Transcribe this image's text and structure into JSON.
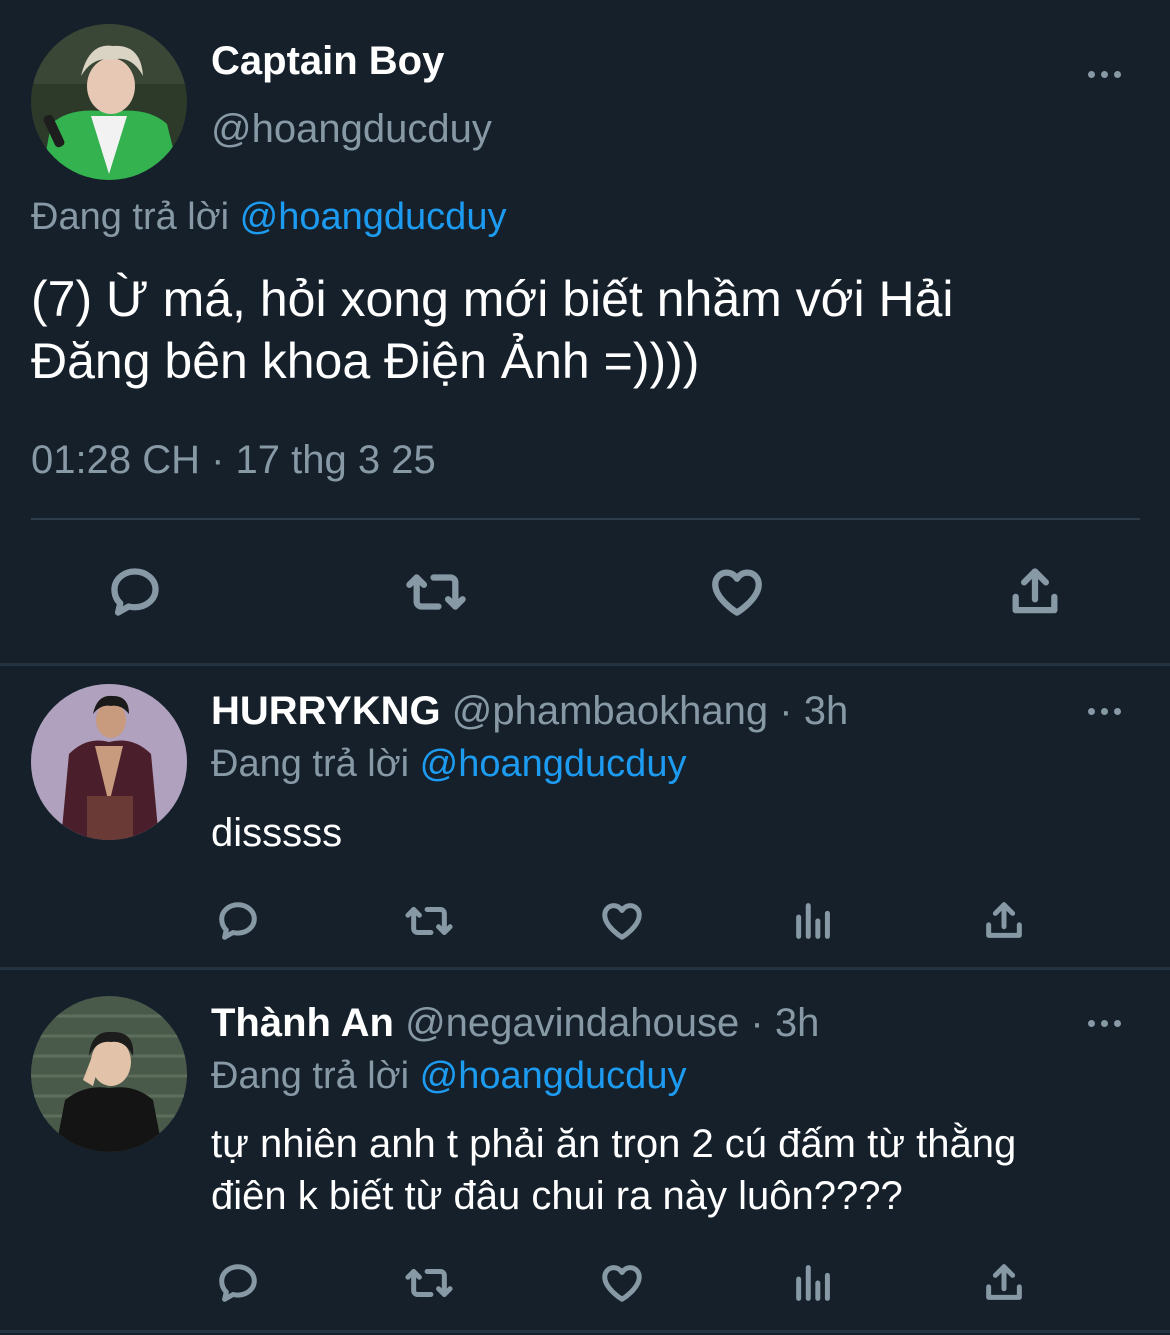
{
  "main_tweet": {
    "display_name": "Captain Boy",
    "handle": "@hoangducduy",
    "replying_label": "Đang trả lời",
    "replying_to": "@hoangducduy",
    "text_line1": "(7) Ừ má, hỏi xong mới biết nhầm với Hải",
    "text_line2": "Đăng bên khoa Điện Ảnh =))))",
    "timestamp": "01:28 CH · 17 thg 3 25",
    "avatar_colors": {
      "bg": "#2d3a2a",
      "jacket": "#33b24f",
      "hair": "#d9d4c4",
      "face": "#e6c8b4"
    }
  },
  "replies": [
    {
      "display_name": "HURRYKNG",
      "handle": "@phambaokhang",
      "time": "· 3h",
      "replying_label": "Đang trả lời",
      "replying_to": "@hoangducduy",
      "text_line1": "disssss",
      "text_line2": "",
      "avatar_colors": {
        "bg": "#b8a9c4",
        "jacket": "#4a1e2a",
        "hair": "#1a1a1a",
        "face": "#c89a7e"
      }
    },
    {
      "display_name": "Thành An",
      "handle": "@negavindahouse",
      "time": "· 3h",
      "replying_label": "Đang trả lời",
      "replying_to": "@hoangducduy",
      "text_line1": "tự nhiên anh t phải ăn trọn 2 cú đấm từ thằng",
      "text_line2": "điên k biết từ đâu chui ra này luôn????",
      "avatar_colors": {
        "bg": "#4a5a4a",
        "jacket": "#141414",
        "hair": "#1c1c1c",
        "face": "#e2c2a8"
      }
    }
  ],
  "icons": {
    "reply": "reply-icon",
    "retweet": "retweet-icon",
    "like": "heart-icon",
    "share": "share-icon",
    "views": "views-icon",
    "more": "more-icon"
  },
  "colors": {
    "background": "#15202b",
    "accent": "#1d9bf0",
    "muted": "#8899a6",
    "divider": "#243340"
  }
}
